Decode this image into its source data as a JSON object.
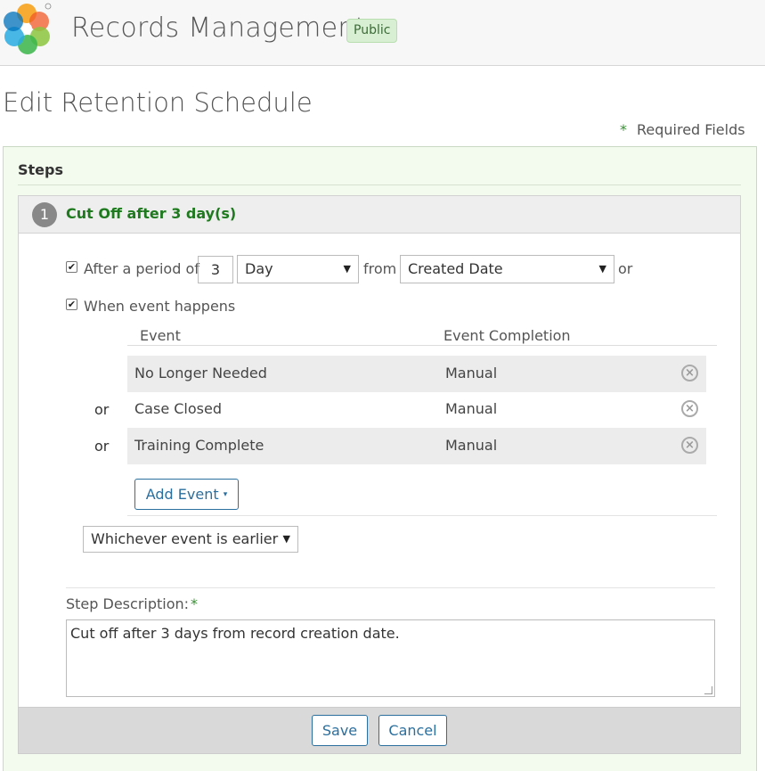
{
  "header": {
    "app_title": "Records Management",
    "site_badge": "Public"
  },
  "page": {
    "title": "Edit Retention Schedule",
    "required_star": "*",
    "required_label": "Required Fields"
  },
  "steps_section": {
    "title": "Steps"
  },
  "step": {
    "number": "1",
    "title": "Cut Off after 3 day(s)",
    "period": {
      "checked": true,
      "label": "After a period of",
      "value": "3",
      "unit": "Day",
      "from_label": "from",
      "from_value": "Created Date",
      "or_label": "or"
    },
    "event": {
      "checked": true,
      "label": "When event happens",
      "col_event": "Event",
      "col_completion": "Event Completion",
      "rows": [
        {
          "prefix": "",
          "name": "No Longer Needed",
          "completion": "Manual"
        },
        {
          "prefix": "or",
          "name": "Case Closed",
          "completion": "Manual"
        },
        {
          "prefix": "or",
          "name": "Training Complete",
          "completion": "Manual"
        }
      ],
      "add_button": "Add Event",
      "combine_value": "Whichever event is earlier"
    },
    "description": {
      "label": "Step Description:",
      "required_star": "*",
      "value": "Cut off after 3 days from record creation date."
    }
  },
  "actions": {
    "save": "Save",
    "cancel": "Cancel"
  },
  "colors": {
    "accent_green": "#1f7a1f",
    "link_blue": "#2a6f9e",
    "panel_tint": "#f3fbef"
  }
}
